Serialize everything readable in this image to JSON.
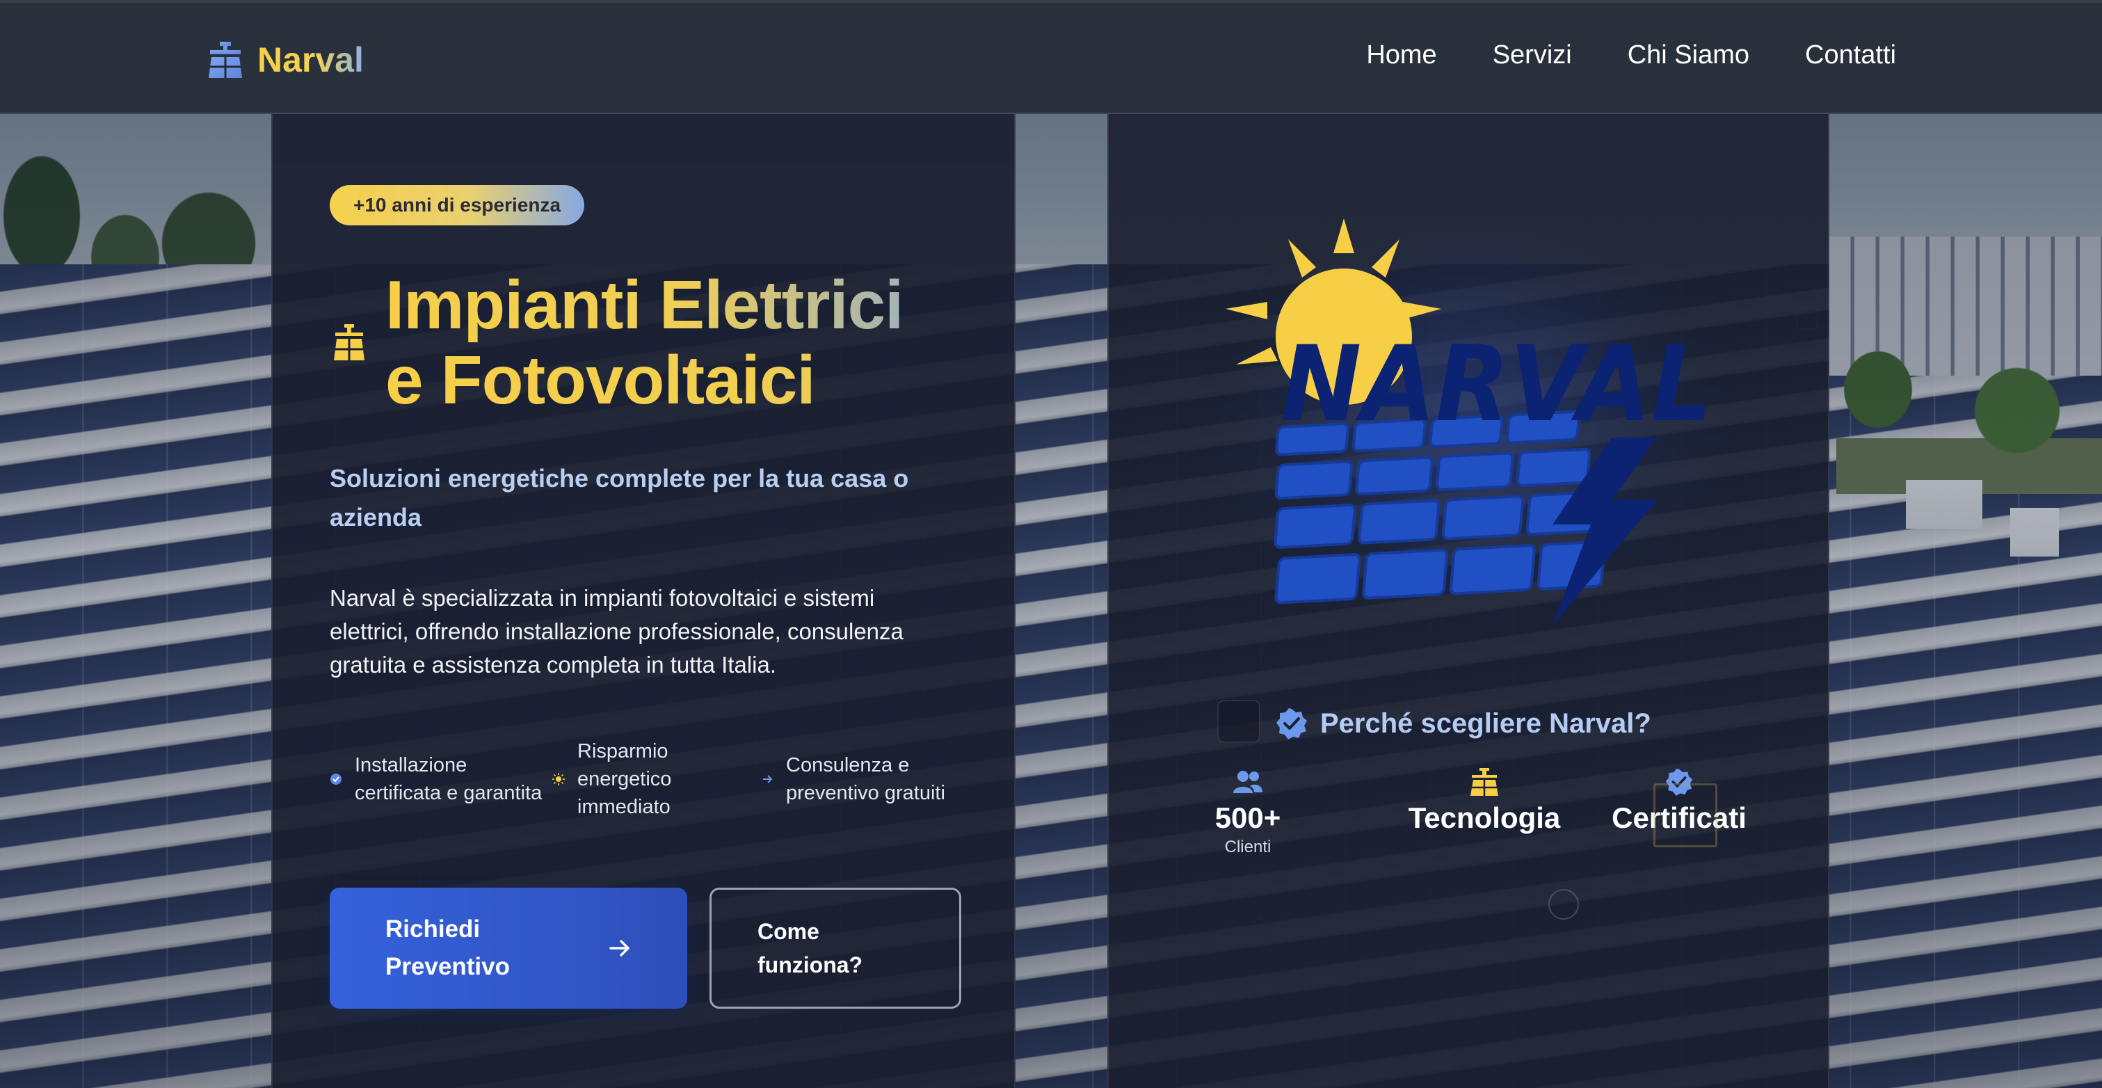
{
  "navbar": {
    "brand": "Narval",
    "links": [
      "Home",
      "Servizi",
      "Chi Siamo",
      "Contatti"
    ]
  },
  "hero": {
    "badge": "+10 anni di esperienza",
    "title_line1": "Impianti Elettrici",
    "title_line2": "e Fotovoltaici",
    "subtitle": "Soluzioni energetiche complete per la tua casa o azienda",
    "description": "Narval è specializzata in impianti fotovoltaici e sistemi elettrici, offrendo installazione professionale, consulenza gratuita e assistenza completa in tutta Italia.",
    "features": [
      {
        "icon": "verified-badge-icon",
        "text": "Installazione certificata e garantita"
      },
      {
        "icon": "sun-icon",
        "text": "Risparmio energetico immediato"
      },
      {
        "icon": "arrow-right-icon",
        "text": "Consulenza e preventivo gratuiti"
      }
    ],
    "primary_button": "Richiedi Preventivo",
    "secondary_button": "Come funziona?"
  },
  "showcase": {
    "logo_text": "NARVAL",
    "why_title": "Perché scegliere Narval?",
    "stats": [
      {
        "icon": "users-icon",
        "value": "500+",
        "label": "Clienti"
      },
      {
        "icon": "solar-panel-icon",
        "value": "Tecnologia",
        "label": ""
      },
      {
        "icon": "verified-badge-icon",
        "value": "Certificati",
        "label": ""
      }
    ]
  },
  "colors": {
    "accent_yellow": "#f7cf48",
    "accent_blue": "#3562dc",
    "light_blue_text": "#b4ccf3",
    "card_bg": "#1a1f30",
    "logo_navy": "#0c2273"
  }
}
